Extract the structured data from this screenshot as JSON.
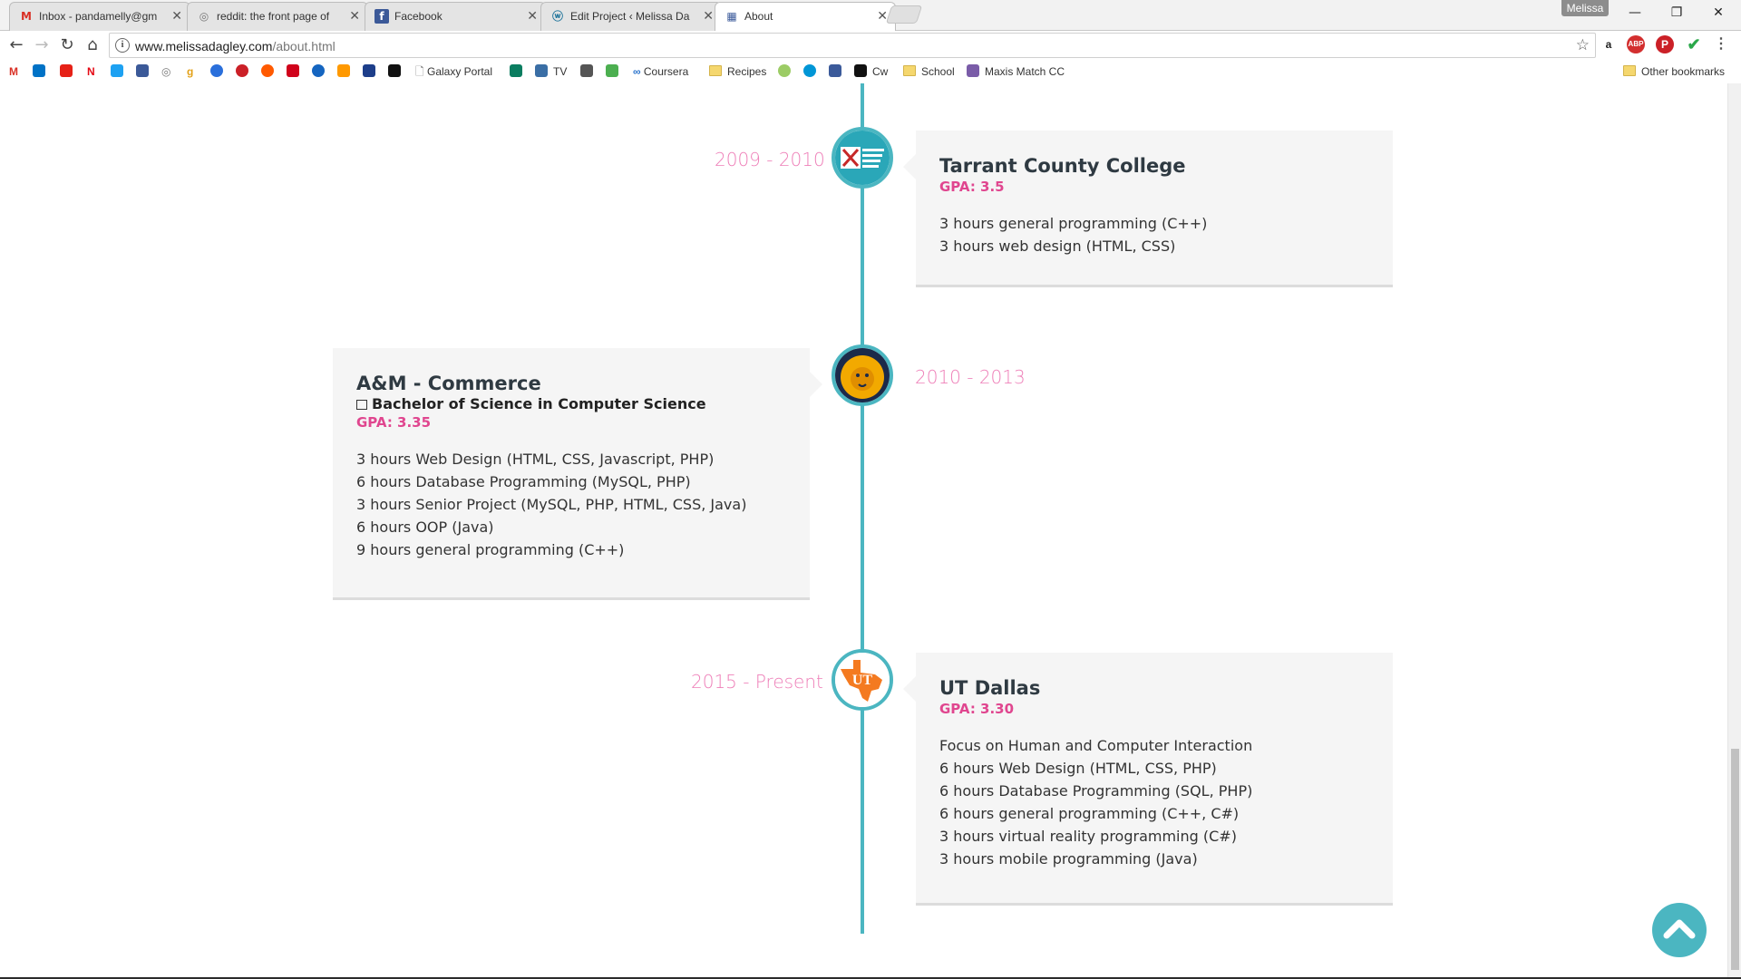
{
  "browser": {
    "tabs": [
      {
        "title": "Inbox - pandamelly@gm",
        "icon": "gmail-icon"
      },
      {
        "title": "reddit: the front page of",
        "icon": "reddit-icon"
      },
      {
        "title": "Facebook",
        "icon": "facebook-icon"
      },
      {
        "title": "Edit Project ‹ Melissa Da",
        "icon": "wordpress-icon"
      },
      {
        "title": "About",
        "icon": "page-icon"
      }
    ],
    "profile_name": "Melissa",
    "url_host": "www.melissadagley.com",
    "url_path": "/about.html",
    "bookmarks": {
      "galaxy_portal": "Galaxy Portal",
      "tv": "TV",
      "coursera": "Coursera",
      "recipes": "Recipes",
      "cw": "Cw",
      "school": "School",
      "maxis_match": "Maxis Match CC",
      "other": "Other bookmarks"
    }
  },
  "timeline": [
    {
      "date": "2009 - 2010",
      "school": "Tarrant County College",
      "degree": "",
      "gpa": "GPA: 3.5",
      "courses": [
        "3 hours general programming (C++)",
        "3 hours web design (HTML, CSS)"
      ],
      "logo": "tarrant-county-college-logo"
    },
    {
      "date": "2010 - 2013",
      "school": "A&M - Commerce",
      "degree": "Bachelor of Science in Computer Science",
      "gpa": "GPA: 3.35",
      "courses": [
        "3 hours Web Design (HTML, CSS, Javascript, PHP)",
        "6 hours Database Programming (MySQL, PHP)",
        "3 hours Senior Project (MySQL, PHP, HTML, CSS, Java)",
        "6 hours OOP (Java)",
        "9 hours general programming (C++)"
      ],
      "logo": "lion-logo"
    },
    {
      "date": "2015 - Present",
      "school": "UT Dallas",
      "degree": "",
      "gpa": "GPA: 3.30",
      "courses": [
        "Focus on Human and Computer Interaction",
        "6 hours Web Design (HTML, CSS, PHP)",
        "6 hours Database Programming (SQL, PHP)",
        "6 hours general programming (C++, C#)",
        "3 hours virtual reality programming (C#)",
        "3 hours mobile programming (Java)"
      ],
      "logo": "ut-texas-logo"
    }
  ],
  "colors": {
    "accent": "#4bb6c1",
    "date": "#ee7fb8",
    "gpa": "#e0468f"
  }
}
